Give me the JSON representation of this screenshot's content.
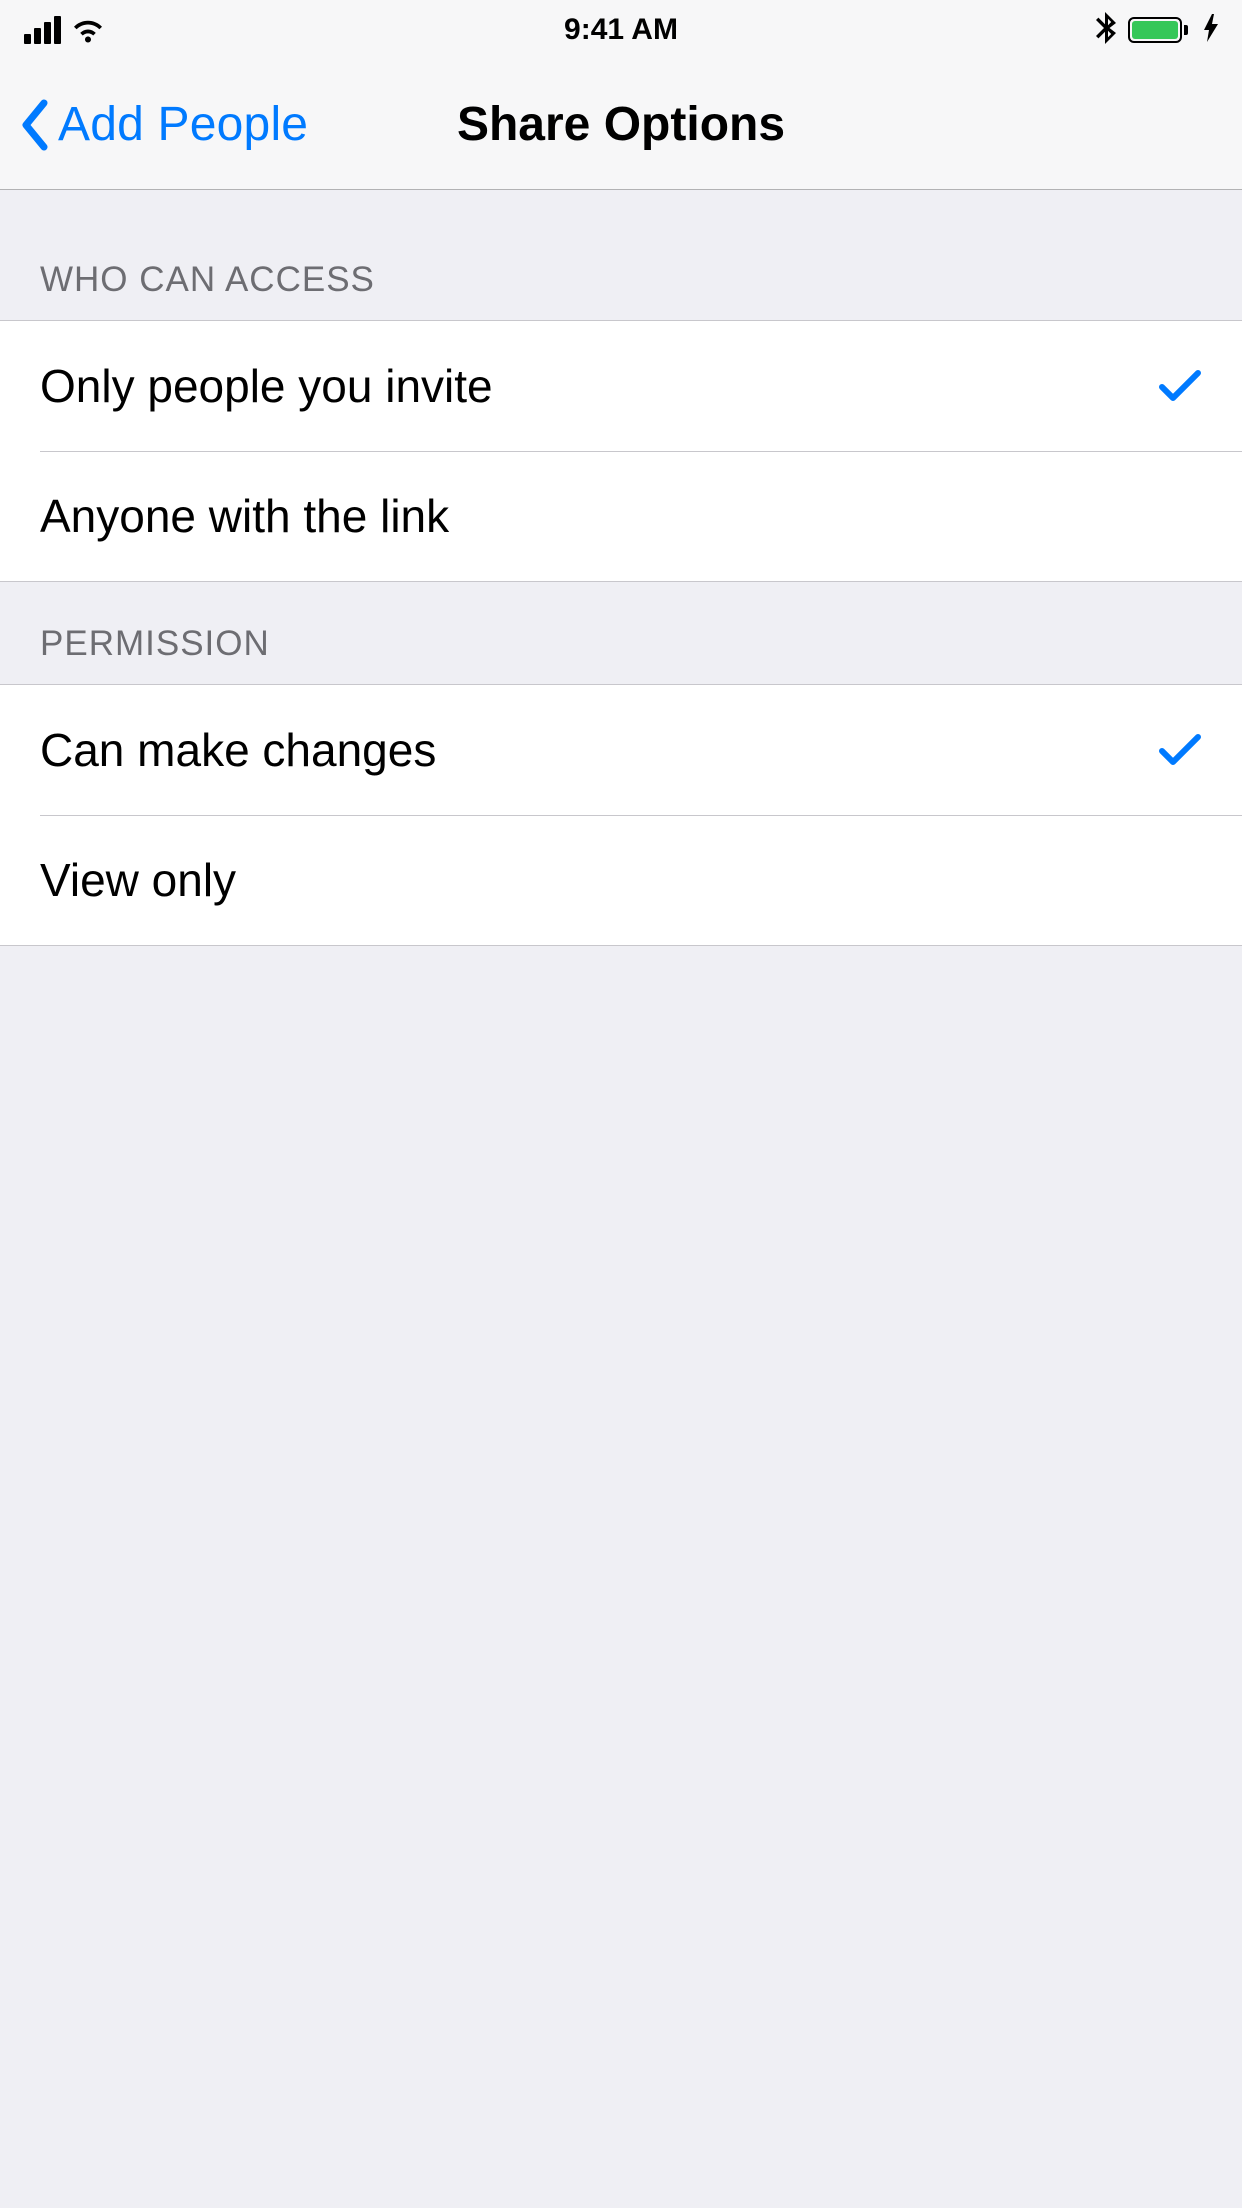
{
  "statusBar": {
    "time": "9:41 AM"
  },
  "nav": {
    "backLabel": "Add People",
    "title": "Share Options"
  },
  "sections": {
    "access": {
      "header": "WHO CAN ACCESS",
      "options": [
        {
          "label": "Only people you invite",
          "selected": true
        },
        {
          "label": "Anyone with the link",
          "selected": false
        }
      ]
    },
    "permission": {
      "header": "PERMISSION",
      "options": [
        {
          "label": "Can make changes",
          "selected": true
        },
        {
          "label": "View only",
          "selected": false
        }
      ]
    }
  }
}
